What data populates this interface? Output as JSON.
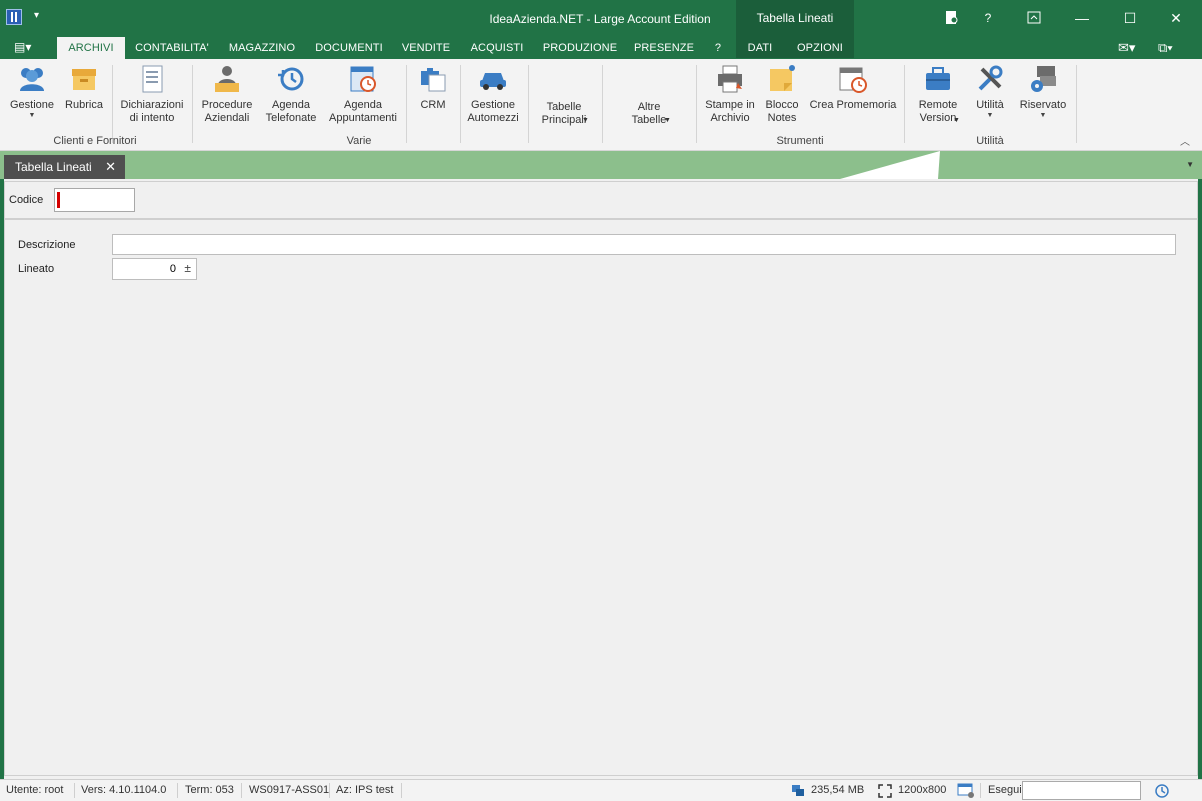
{
  "window": {
    "title": "IdeaAzienda.NET - Large Account Edition",
    "context_tab_group": "Tabella Lineati",
    "controls": [
      "?",
      "—",
      "☐",
      "✕"
    ]
  },
  "ribbon_tabs": [
    {
      "label": "ARCHIVI",
      "active": true
    },
    {
      "label": "CONTABILITA'"
    },
    {
      "label": "MAGAZZINO"
    },
    {
      "label": "DOCUMENTI"
    },
    {
      "label": "VENDITE"
    },
    {
      "label": "ACQUISTI"
    },
    {
      "label": "PRODUZIONE"
    },
    {
      "label": "PRESENZE"
    },
    {
      "label": "?"
    },
    {
      "label": "DATI"
    },
    {
      "label": "OPZIONI"
    }
  ],
  "ribbon": {
    "buttons": [
      {
        "label": "Gestione",
        "icon": "users-icon"
      },
      {
        "label": "Rubrica",
        "icon": "box-icon"
      },
      {
        "label": "Dichiarazioni di intento",
        "icon": "document-icon"
      },
      {
        "label": "Procedure Aziendali",
        "icon": "person-desk-icon"
      },
      {
        "label": "Agenda Telefonate",
        "icon": "history-icon"
      },
      {
        "label": "Agenda Appuntamenti",
        "icon": "calendar-clock-icon"
      },
      {
        "label": "CRM",
        "icon": "crm-icon"
      },
      {
        "label": "Gestione Automezzi",
        "icon": "car-icon"
      },
      {
        "label": "Tabelle Principali",
        "icon": ""
      },
      {
        "label": "Altre Tabelle",
        "icon": ""
      },
      {
        "label": "Stampe in Archivio",
        "icon": "printer-icon"
      },
      {
        "label": "Blocco Notes",
        "icon": "sticky-note-icon"
      },
      {
        "label": "Crea Promemoria",
        "icon": "reminder-icon"
      },
      {
        "label": "Remote Version",
        "icon": "briefcase-icon"
      },
      {
        "label": "Utilità",
        "icon": "tools-icon"
      },
      {
        "label": "Riservato",
        "icon": "settings-windows-icon"
      }
    ],
    "groups": [
      "Clienti e Fornitori",
      "Varie",
      "Strumenti",
      "Utilità"
    ]
  },
  "doc_tab": {
    "label": "Tabella Lineati",
    "close": "✕"
  },
  "form": {
    "codice_label": "Codice",
    "codice_value": "",
    "descrizione_label": "Descrizione",
    "descrizione_value": "",
    "lineato_label": "Lineato",
    "lineato_value": "0",
    "spin_glyph": "±"
  },
  "status": {
    "utente": "Utente: root",
    "versione": "Vers: 4.10.1104.0",
    "term": "Term: 053",
    "workstation": "WS0917-ASS01",
    "azienda": "Az: IPS test",
    "memory": "235,54 MB",
    "resolution": "1200x800",
    "esegui": "Esegui"
  },
  "colors": {
    "accent": "#217346",
    "doc_strip": "#8cbf8c",
    "required_marker": "#d40000"
  }
}
